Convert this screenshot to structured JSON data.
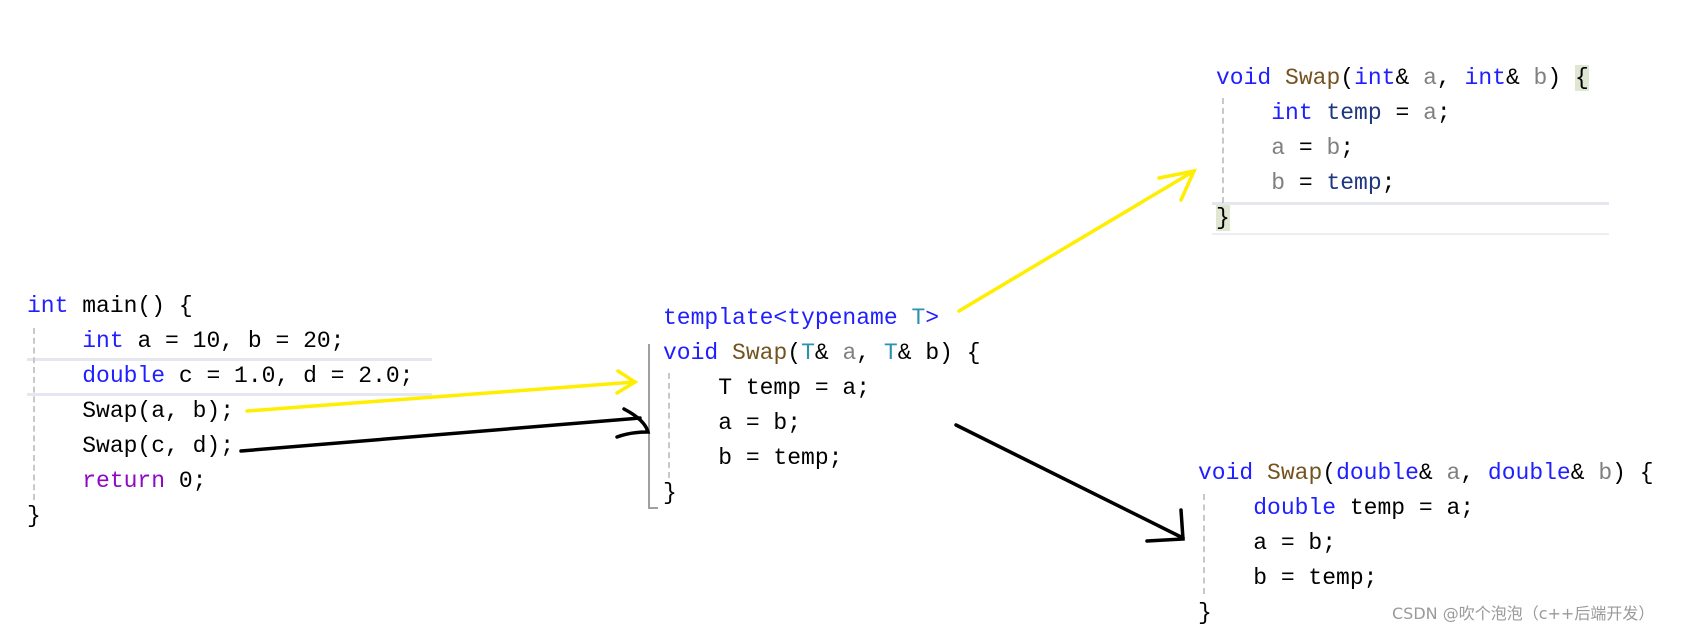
{
  "colors": {
    "keyword": "#1f1fff",
    "function": "#74531f",
    "parameter": "#808080",
    "local": "#1f377f",
    "type_param": "#2b91af",
    "control": "#8f08c4",
    "yellow_arrow": "#ffee00",
    "black_arrow": "#000000"
  },
  "blocks": {
    "main": [
      [
        {
          "t": "int",
          "c": "kw"
        },
        {
          "t": " main() {",
          "c": "plain"
        }
      ],
      [
        {
          "t": "    ",
          "c": "plain"
        },
        {
          "t": "int",
          "c": "kw"
        },
        {
          "t": " a = 10, b = 20;",
          "c": "plain"
        }
      ],
      [
        {
          "t": "    ",
          "c": "plain"
        },
        {
          "t": "double",
          "c": "kw"
        },
        {
          "t": " c = 1.0, d = 2.0;",
          "c": "plain"
        }
      ],
      [
        {
          "t": "    Swap(a, b);",
          "c": "plain"
        }
      ],
      [
        {
          "t": "    Swap(c, d);",
          "c": "plain"
        }
      ],
      [
        {
          "t": "    ",
          "c": "plain"
        },
        {
          "t": "return",
          "c": "ctrl"
        },
        {
          "t": " 0;",
          "c": "plain"
        }
      ],
      [
        {
          "t": "}",
          "c": "plain"
        }
      ]
    ],
    "template": [
      [
        {
          "t": "template<typename ",
          "c": "kw"
        },
        {
          "t": "T",
          "c": "type"
        },
        {
          "t": ">",
          "c": "kw"
        }
      ],
      [
        {
          "t": "void",
          "c": "kw"
        },
        {
          "t": " ",
          "c": "plain"
        },
        {
          "t": "Swap",
          "c": "fn"
        },
        {
          "t": "(",
          "c": "plain"
        },
        {
          "t": "T",
          "c": "type"
        },
        {
          "t": "& ",
          "c": "plain"
        },
        {
          "t": "a",
          "c": "param"
        },
        {
          "t": ", ",
          "c": "plain"
        },
        {
          "t": "T",
          "c": "type"
        },
        {
          "t": "& b) {",
          "c": "plain"
        }
      ],
      [
        {
          "t": "    T temp = a;",
          "c": "plain"
        }
      ],
      [
        {
          "t": "    a = b;",
          "c": "plain"
        }
      ],
      [
        {
          "t": "    b = temp;",
          "c": "plain"
        }
      ],
      [
        {
          "t": "}",
          "c": "plain"
        }
      ]
    ],
    "int_swap": [
      [
        {
          "t": "void",
          "c": "kw"
        },
        {
          "t": " ",
          "c": "plain"
        },
        {
          "t": "Swap",
          "c": "fn"
        },
        {
          "t": "(",
          "c": "plain"
        },
        {
          "t": "int",
          "c": "kw"
        },
        {
          "t": "& ",
          "c": "plain"
        },
        {
          "t": "a",
          "c": "param"
        },
        {
          "t": ", ",
          "c": "plain"
        },
        {
          "t": "int",
          "c": "kw"
        },
        {
          "t": "& ",
          "c": "plain"
        },
        {
          "t": "b",
          "c": "param"
        },
        {
          "t": ") ",
          "c": "plain"
        },
        {
          "t": "{",
          "c": "plain bracebg"
        }
      ],
      [
        {
          "t": "    ",
          "c": "plain"
        },
        {
          "t": "int",
          "c": "kw"
        },
        {
          "t": " ",
          "c": "plain"
        },
        {
          "t": "temp",
          "c": "local"
        },
        {
          "t": " = ",
          "c": "plain"
        },
        {
          "t": "a",
          "c": "param"
        },
        {
          "t": ";",
          "c": "plain"
        }
      ],
      [
        {
          "t": "    ",
          "c": "plain"
        },
        {
          "t": "a",
          "c": "param"
        },
        {
          "t": " = ",
          "c": "plain"
        },
        {
          "t": "b",
          "c": "param"
        },
        {
          "t": ";",
          "c": "plain"
        }
      ],
      [
        {
          "t": "    ",
          "c": "plain"
        },
        {
          "t": "b",
          "c": "param"
        },
        {
          "t": " = ",
          "c": "plain"
        },
        {
          "t": "temp",
          "c": "local"
        },
        {
          "t": ";",
          "c": "plain"
        }
      ],
      [
        {
          "t": "}",
          "c": "plain bracebg"
        }
      ]
    ],
    "double_swap": [
      [
        {
          "t": "void",
          "c": "kw"
        },
        {
          "t": " ",
          "c": "plain"
        },
        {
          "t": "Swap",
          "c": "fn"
        },
        {
          "t": "(",
          "c": "plain"
        },
        {
          "t": "double",
          "c": "kw"
        },
        {
          "t": "& ",
          "c": "plain"
        },
        {
          "t": "a",
          "c": "param"
        },
        {
          "t": ", ",
          "c": "plain"
        },
        {
          "t": "double",
          "c": "kw"
        },
        {
          "t": "& ",
          "c": "plain"
        },
        {
          "t": "b",
          "c": "param"
        },
        {
          "t": ") {",
          "c": "plain"
        }
      ],
      [
        {
          "t": "    ",
          "c": "plain"
        },
        {
          "t": "double",
          "c": "kw"
        },
        {
          "t": " temp = a;",
          "c": "plain"
        }
      ],
      [
        {
          "t": "    a = b;",
          "c": "plain"
        }
      ],
      [
        {
          "t": "    b = temp;",
          "c": "plain"
        }
      ],
      [
        {
          "t": "}",
          "c": "plain"
        }
      ]
    ]
  },
  "watermark": "CSDN @吹个泡泡（c++后端开发）"
}
